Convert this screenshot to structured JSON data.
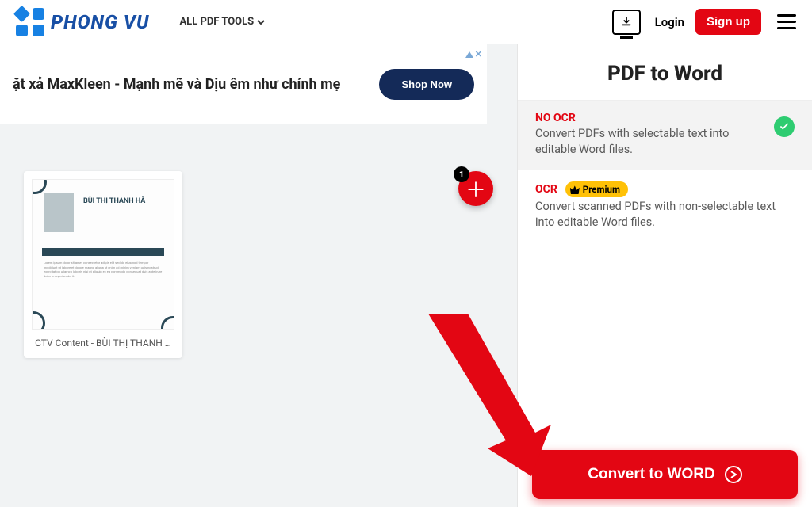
{
  "header": {
    "brand": "PHONG VU",
    "tools_label": "ALL PDF TOOLS",
    "login": "Login",
    "signup": "Sign up"
  },
  "ad": {
    "text": "ặt xả MaxKleen - Mạnh mẽ và Dịu êm như chính mẹ",
    "cta": "Shop Now"
  },
  "file": {
    "display_name": "CTV Content - BÙI THỊ THANH …",
    "thumb_name": "BÙI THỊ THANH HÀ"
  },
  "fab": {
    "count": "1"
  },
  "panel": {
    "title": "PDF to Word",
    "options": [
      {
        "key": "no_ocr",
        "title": "NO OCR",
        "desc": "Convert PDFs with selectable text into editable Word files.",
        "selected": true,
        "premium": false
      },
      {
        "key": "ocr",
        "title": "OCR",
        "desc": "Convert scanned PDFs with non-selectable text into editable Word files.",
        "selected": false,
        "premium": true
      }
    ],
    "premium_label": "Premium",
    "convert_label": "Convert to WORD"
  }
}
